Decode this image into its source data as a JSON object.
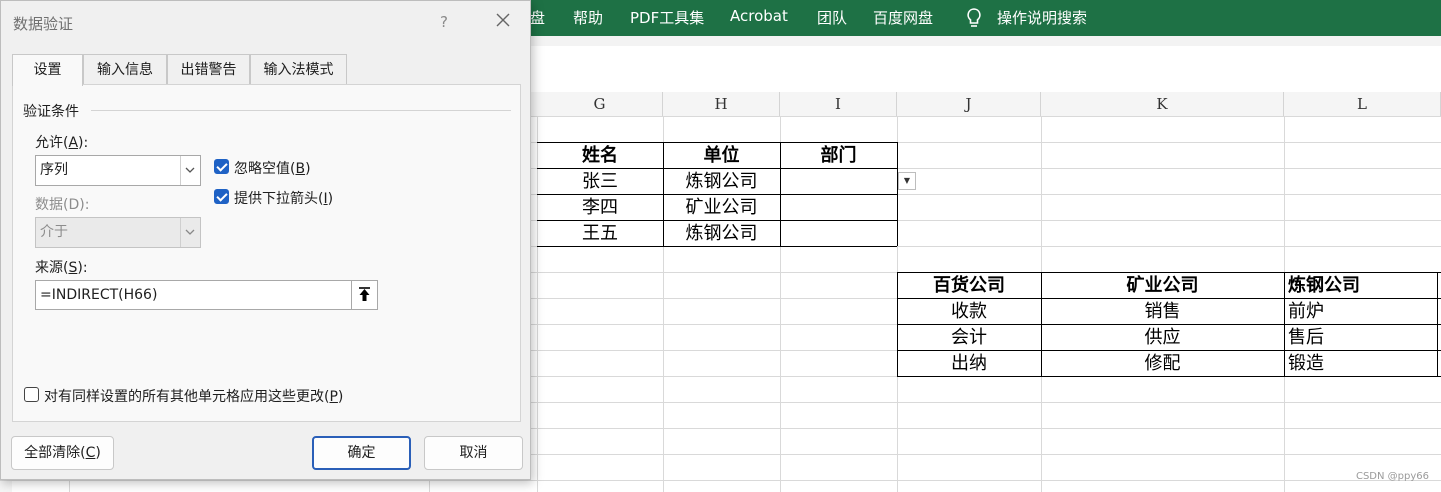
{
  "ribbon": {
    "menu": [
      "盘",
      "帮助",
      "PDF工具集",
      "Acrobat",
      "团队",
      "百度网盘"
    ],
    "search_label": "操作说明搜索"
  },
  "sheet": {
    "columns": [
      "G",
      "H",
      "I",
      "J",
      "K",
      "L"
    ],
    "table1": {
      "headers": [
        "姓名",
        "单位",
        "部门"
      ],
      "rows": [
        [
          "张三",
          "炼钢公司",
          ""
        ],
        [
          "李四",
          "矿业公司",
          ""
        ],
        [
          "王五",
          "炼钢公司",
          ""
        ]
      ]
    },
    "table2": {
      "headers": [
        "百货公司",
        "矿业公司",
        "炼钢公司"
      ],
      "rows": [
        [
          "收款",
          "销售",
          "前炉"
        ],
        [
          "会计",
          "供应",
          "售后"
        ],
        [
          "出纳",
          "修配",
          "锻造"
        ]
      ]
    },
    "dropdown_arrow": "▼",
    "watermark": "CSDN @ppy66"
  },
  "dialog": {
    "title": "数据验证",
    "help": "?",
    "tabs": [
      "设置",
      "输入信息",
      "出错警告",
      "输入法模式"
    ],
    "active_tab": 0,
    "group_title": "验证条件",
    "allow": {
      "label": "允许(",
      "key": "A",
      "suffix": "):",
      "value": "序列"
    },
    "data": {
      "label": "数据(D):",
      "value": "介于"
    },
    "ignore_blank": {
      "label": "忽略空值(",
      "key": "B",
      "suffix": ")",
      "checked": true
    },
    "in_cell_dropdown": {
      "label": "提供下拉箭头(",
      "key": "I",
      "suffix": ")",
      "checked": true
    },
    "source": {
      "label": "来源(",
      "key": "S",
      "suffix": "):",
      "value": "=INDIRECT(H66)"
    },
    "apply_all": {
      "label": "对有同样设置的所有其他单元格应用这些更改(",
      "key": "P",
      "suffix": ")",
      "checked": false
    },
    "clear_all": {
      "label": "全部清除(",
      "key": "C",
      "suffix": ")"
    },
    "ok": "确定",
    "cancel": "取消"
  },
  "colors": {
    "ribbon": "#1e7145",
    "accent": "#1f62c5"
  }
}
